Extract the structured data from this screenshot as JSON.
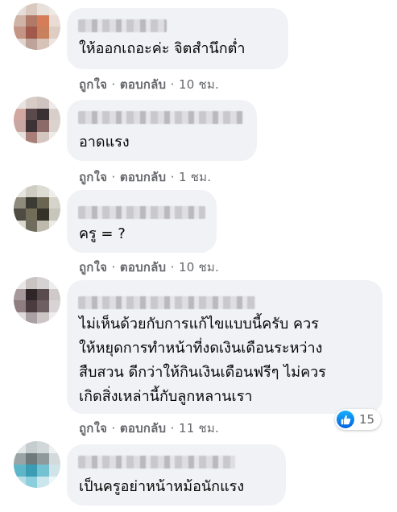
{
  "comments": [
    {
      "text": "ให้ออกเถอะค่ะ จิตสำนึกต่ำ",
      "like_label": "ถูกใจ",
      "reply_label": "ตอบกลับ",
      "time": "10 ชม."
    },
    {
      "text": "อาดแรง",
      "like_label": "ถูกใจ",
      "reply_label": "ตอบกลับ",
      "time": "1 ชม."
    },
    {
      "text": "ครู = ?",
      "like_label": "ถูกใจ",
      "reply_label": "ตอบกลับ",
      "time": "10 ชม."
    },
    {
      "text": "ไม่เห็นด้วยกับการแก้ไขแบบนี้ครับ ควร\nให้หยุดการทำหน้าที่งดเงินเดือนระหว่าง\nสืบสวน ดีกว่าให้กินเงินเดือนฟรีๆ ไม่ควร\nเกิดสิ่งเหล่านี้กับลูกหลานเรา",
      "like_label": "ถูกใจ",
      "reply_label": "ตอบกลับ",
      "time": "11 ชม.",
      "reaction_count": "15"
    },
    {
      "text": "เป็นครูอย่าหน้าหม้อนักแรง"
    }
  ],
  "separator": "·",
  "colors": {
    "bubble": "#f0f2f5",
    "meta": "#65676b",
    "like_blue": "#1877f2"
  },
  "icons": {
    "reaction": "like-thumb-icon"
  }
}
